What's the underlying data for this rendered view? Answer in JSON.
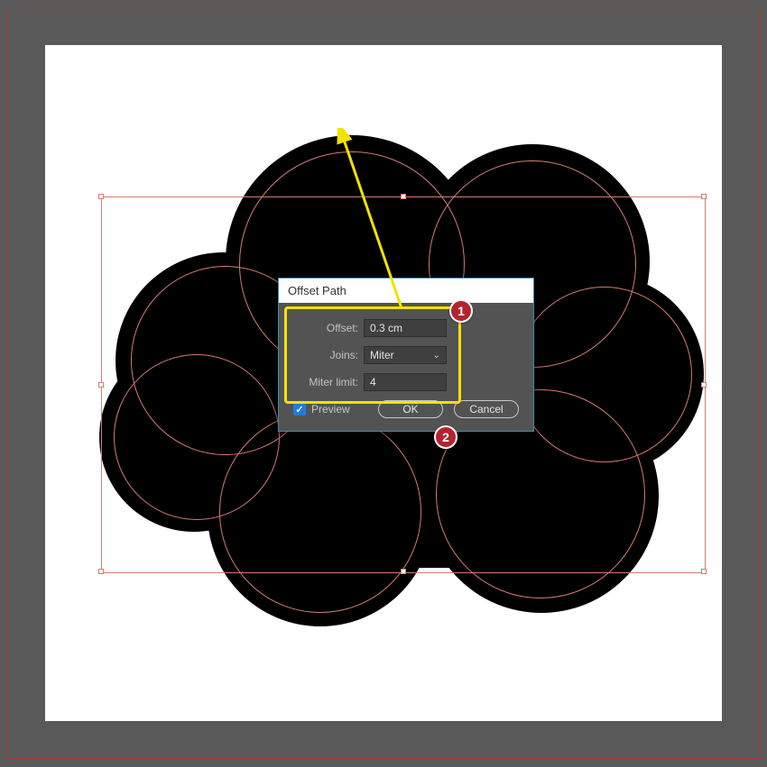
{
  "dialog": {
    "title": "Offset Path",
    "offset_label": "Offset:",
    "offset_value": "0.3 cm",
    "joins_label": "Joins:",
    "joins_value": "Miter",
    "miter_label": "Miter limit:",
    "miter_value": "4",
    "preview_label": "Preview",
    "preview_checked": true,
    "ok_label": "OK",
    "cancel_label": "Cancel"
  },
  "annotations": {
    "badge1": "1",
    "badge2": "2"
  }
}
